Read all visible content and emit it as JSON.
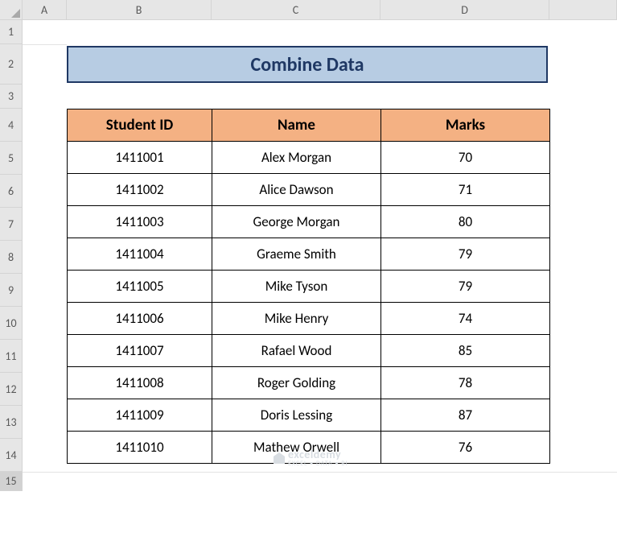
{
  "columns": [
    "A",
    "B",
    "C",
    "D"
  ],
  "rows": [
    "1",
    "2",
    "3",
    "4",
    "5",
    "6",
    "7",
    "8",
    "9",
    "10",
    "11",
    "12",
    "13",
    "14",
    "15"
  ],
  "title": "Combine Data",
  "table": {
    "headers": [
      "Student ID",
      "Name",
      "Marks"
    ],
    "data": [
      [
        "1411001",
        "Alex Morgan",
        "70"
      ],
      [
        "1411002",
        "Alice Dawson",
        "71"
      ],
      [
        "1411003",
        "George Morgan",
        "80"
      ],
      [
        "1411004",
        "Graeme Smith",
        "79"
      ],
      [
        "1411005",
        "Mike Tyson",
        "79"
      ],
      [
        "1411006",
        "Mike Henry",
        "74"
      ],
      [
        "1411007",
        "Rafael Wood",
        "85"
      ],
      [
        "1411008",
        "Roger Golding",
        "78"
      ],
      [
        "1411009",
        "Doris Lessing",
        "87"
      ],
      [
        "1411010",
        "Mathew Orwell",
        "76"
      ]
    ]
  },
  "watermark": {
    "brand": "exceldemy",
    "tag": "EXCEL • DATA • BI"
  },
  "layout": {
    "colWidths": {
      "rowhdr": 28,
      "A": 55,
      "B": 180,
      "C": 210,
      "D": 210,
      "E": 84
    },
    "rowHeights": {
      "hdr": 25,
      "1": 30,
      "2": 50,
      "3": 30,
      "4": 41,
      "5": 41,
      "6": 41,
      "7": 41,
      "8": 41,
      "9": 41,
      "10": 41,
      "11": 41,
      "12": 41,
      "13": 41,
      "14": 41,
      "15": 24
    }
  }
}
